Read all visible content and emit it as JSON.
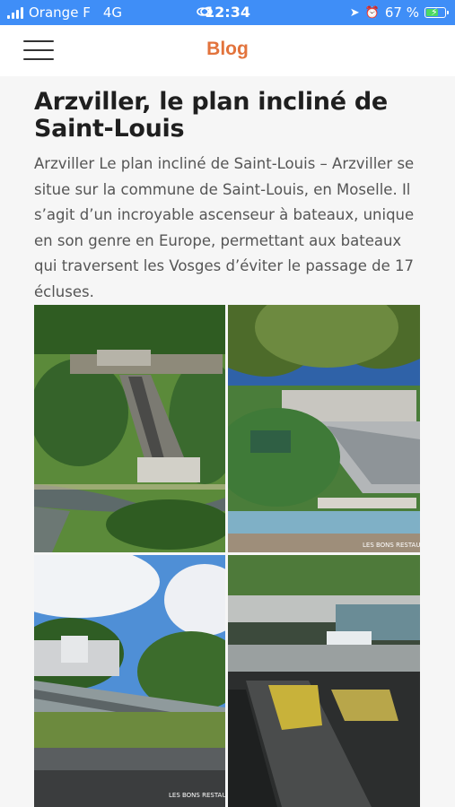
{
  "status_bar": {
    "carrier": "Orange F",
    "network": "4G",
    "time": "12:34",
    "battery": "67 %",
    "battery_level": 0.67
  },
  "nav": {
    "title": "Blog",
    "title_color": "#e2733c"
  },
  "article": {
    "title": "Arzviller, le plan incliné de Saint-Louis",
    "excerpt": "Arzviller Le plan incliné de Saint-Louis – Arzviller se situe sur la commune de Saint-Louis, en Moselle. Il s’agit d’un incroyable ascenseur à bateaux, unique en son genre en Europe, permettant aux bateaux qui traversent les Vosges d’éviter le passage de 17 écluses."
  },
  "gallery": {
    "watermark": "LES BONS RESTAU"
  }
}
